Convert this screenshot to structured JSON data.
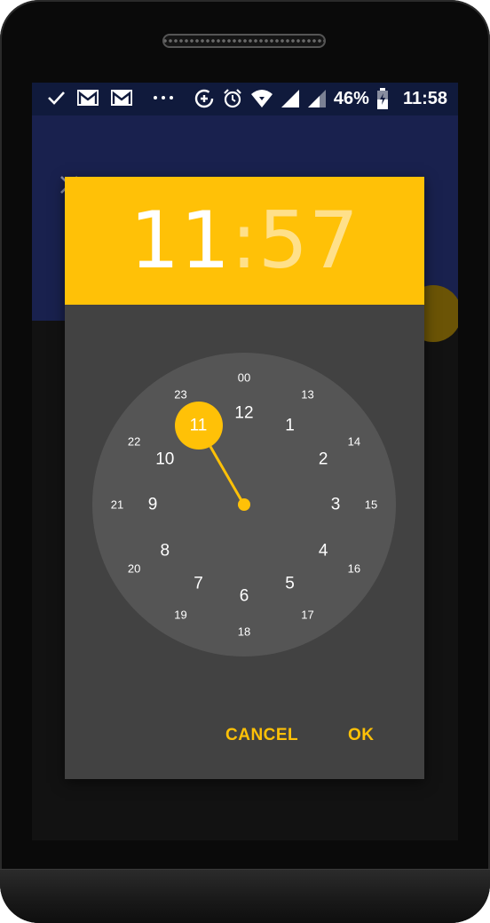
{
  "status_bar": {
    "battery_percent": "46%",
    "time": "11:58",
    "icons": [
      "check-icon",
      "gmail-icon",
      "gmail-icon",
      "more-dots-icon",
      "data-saver-icon",
      "alarm-icon",
      "wifi-icon",
      "signal-icon",
      "signal-icon",
      "battery-charging-icon"
    ]
  },
  "app_bar": {
    "close_icon": "close-icon"
  },
  "dialog": {
    "hour": "11",
    "separator": ":",
    "minute": "57",
    "outer_numbers": [
      "12",
      "1",
      "2",
      "3",
      "4",
      "5",
      "6",
      "7",
      "8",
      "9",
      "10",
      "11"
    ],
    "inner_numbers": [
      "00",
      "13",
      "14",
      "15",
      "16",
      "17",
      "18",
      "19",
      "20",
      "21",
      "22",
      "23"
    ],
    "selected_hour": "11",
    "cancel_label": "CANCEL",
    "ok_label": "OK"
  },
  "colors": {
    "accent": "#ffc107",
    "status_bar": "#101a3c",
    "app_bar": "#19214e",
    "dialog_bg": "#424242",
    "clock_face": "#555555"
  }
}
